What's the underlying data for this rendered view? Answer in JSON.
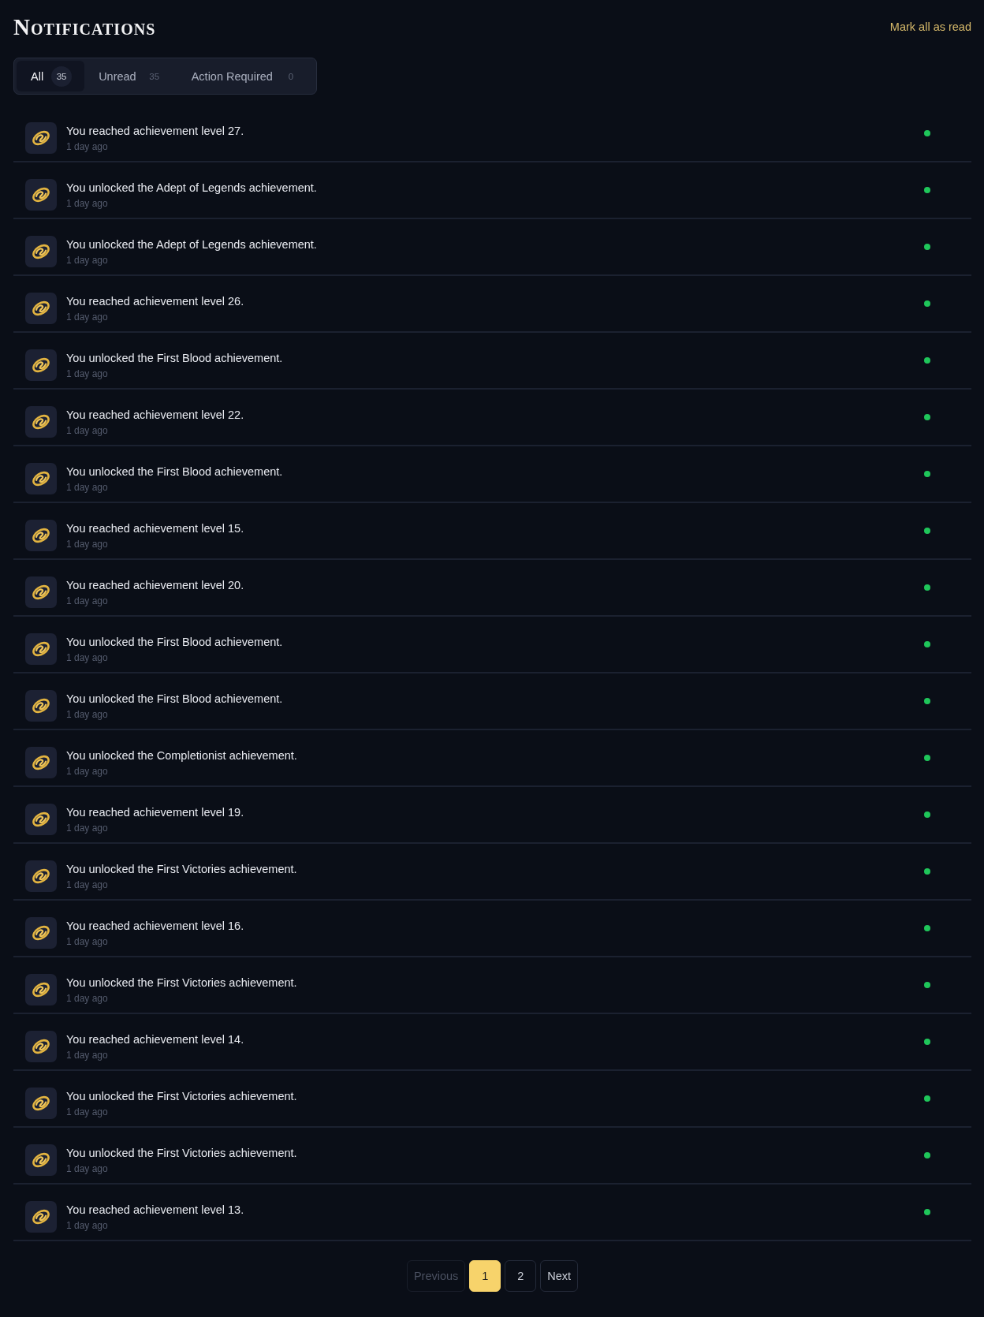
{
  "header": {
    "title": "Notifications",
    "mark_all": "Mark all as read"
  },
  "tabs": [
    {
      "label": "All",
      "count": "35",
      "selected": true
    },
    {
      "label": "Unread",
      "count": "35",
      "selected": false
    },
    {
      "label": "Action Required",
      "count": "0",
      "selected": false
    }
  ],
  "notifications": [
    {
      "message": "You reached achievement level 27.",
      "time": "1 day ago",
      "unread": true
    },
    {
      "message": "You unlocked the Adept of Legends achievement.",
      "time": "1 day ago",
      "unread": true
    },
    {
      "message": "You unlocked the Adept of Legends achievement.",
      "time": "1 day ago",
      "unread": true
    },
    {
      "message": "You reached achievement level 26.",
      "time": "1 day ago",
      "unread": true
    },
    {
      "message": "You unlocked the First Blood achievement.",
      "time": "1 day ago",
      "unread": true
    },
    {
      "message": "You reached achievement level 22.",
      "time": "1 day ago",
      "unread": true
    },
    {
      "message": "You unlocked the First Blood achievement.",
      "time": "1 day ago",
      "unread": true
    },
    {
      "message": "You reached achievement level 15.",
      "time": "1 day ago",
      "unread": true
    },
    {
      "message": "You reached achievement level 20.",
      "time": "1 day ago",
      "unread": true
    },
    {
      "message": "You unlocked the First Blood achievement.",
      "time": "1 day ago",
      "unread": true
    },
    {
      "message": "You unlocked the First Blood achievement.",
      "time": "1 day ago",
      "unread": true
    },
    {
      "message": "You unlocked the Completionist achievement.",
      "time": "1 day ago",
      "unread": true
    },
    {
      "message": "You reached achievement level 19.",
      "time": "1 day ago",
      "unread": true
    },
    {
      "message": "You unlocked the First Victories achievement.",
      "time": "1 day ago",
      "unread": true
    },
    {
      "message": "You reached achievement level 16.",
      "time": "1 day ago",
      "unread": true
    },
    {
      "message": "You unlocked the First Victories achievement.",
      "time": "1 day ago",
      "unread": true
    },
    {
      "message": "You reached achievement level 14.",
      "time": "1 day ago",
      "unread": true
    },
    {
      "message": "You unlocked the First Victories achievement.",
      "time": "1 day ago",
      "unread": true
    },
    {
      "message": "You unlocked the First Victories achievement.",
      "time": "1 day ago",
      "unread": true
    },
    {
      "message": "You reached achievement level 13.",
      "time": "1 day ago",
      "unread": true
    }
  ],
  "pagination": {
    "previous": {
      "label": "Previous",
      "disabled": true
    },
    "pages": [
      {
        "label": "1",
        "selected": true
      },
      {
        "label": "2",
        "selected": false
      }
    ],
    "next": {
      "label": "Next",
      "disabled": false
    }
  }
}
